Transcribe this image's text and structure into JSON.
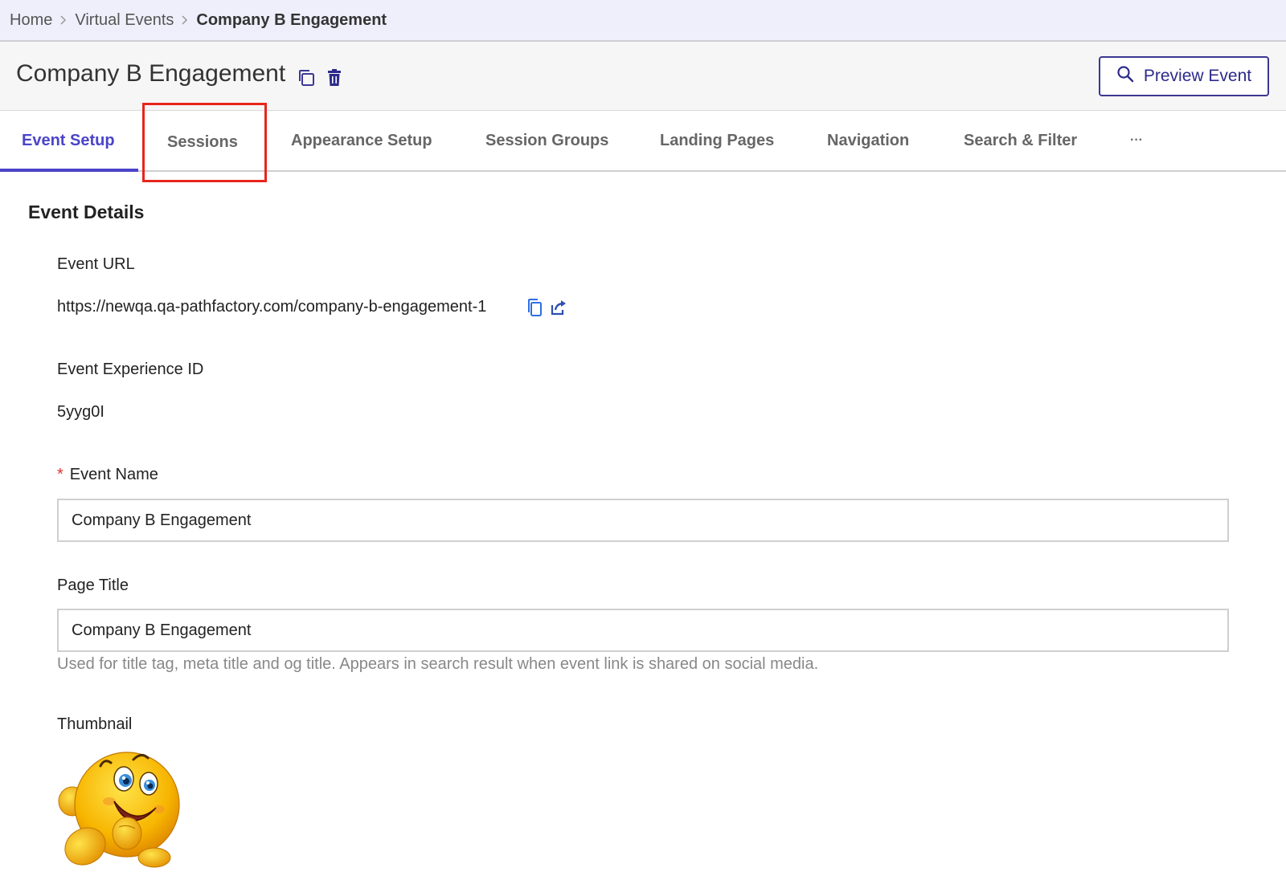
{
  "breadcrumb": {
    "items": [
      "Home",
      "Virtual Events"
    ],
    "current": "Company B Engagement"
  },
  "header": {
    "title": "Company B Engagement",
    "preview_label": "Preview Event"
  },
  "tabs": [
    {
      "label": "Event Setup"
    },
    {
      "label": "Sessions"
    },
    {
      "label": "Appearance Setup"
    },
    {
      "label": "Session Groups"
    },
    {
      "label": "Landing Pages"
    },
    {
      "label": "Navigation"
    },
    {
      "label": "Search & Filter"
    },
    {
      "label": "···"
    }
  ],
  "event_details": {
    "heading": "Event Details",
    "url_label": "Event URL",
    "url_value": "https://newqa.qa-pathfactory.com/company-b-engagement-1",
    "experience_id_label": "Event Experience ID",
    "experience_id_value": "5yyg0I",
    "required_mark": "*",
    "event_name_label": "Event Name",
    "event_name_value": "Company B Engagement",
    "page_title_label": "Page Title",
    "page_title_value": "Company B Engagement",
    "page_title_help": "Used for title tag, meta title and og title. Appears in search result when event link is shared on social media.",
    "thumbnail_label": "Thumbnail"
  },
  "colors": {
    "accent": "#4b44c8",
    "link_icon": "#2f6fe0",
    "highlight_border": "#e8251c",
    "required": "#e0312a"
  }
}
